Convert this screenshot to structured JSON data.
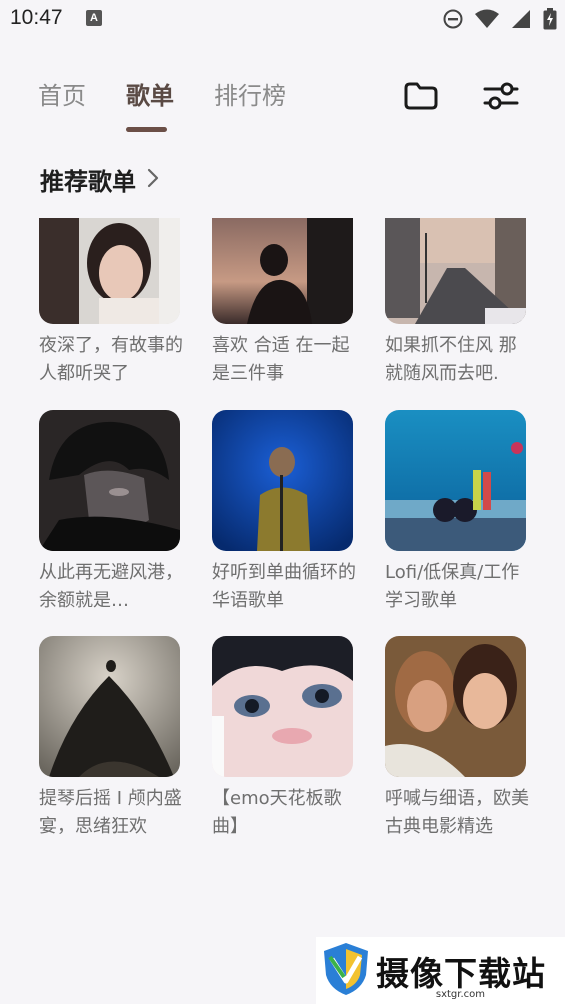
{
  "status_bar": {
    "time": "10:47",
    "app_badge": "A"
  },
  "tabs": [
    {
      "label": "首页",
      "active": false
    },
    {
      "label": "歌单",
      "active": true
    },
    {
      "label": "排行榜",
      "active": false
    }
  ],
  "header_icons": [
    "folder-icon",
    "filter-sliders-icon"
  ],
  "section": {
    "title": "推荐歌单"
  },
  "playlists": [
    {
      "title": "夜深了，有故事的人都听哭了"
    },
    {
      "title": "喜欢 合适 在一起 是三件事"
    },
    {
      "title": "如果抓不住风 那就随风而去吧."
    },
    {
      "title": "从此再无避风港，余额就是…"
    },
    {
      "title": "好听到单曲循环的华语歌单"
    },
    {
      "title": "Lofi/低保真/工作学习歌单"
    },
    {
      "title": "提琴后摇 I 颅内盛宴，思绪狂欢"
    },
    {
      "title": "【emo天花板歌曲】"
    },
    {
      "title": "呼喊与细语，欧美古典电影精选"
    }
  ],
  "watermark": {
    "text": "摄像下载站",
    "url": "sxtgr.com"
  },
  "colors": {
    "accent": "#6b4f47",
    "background": "#f6f5f8",
    "caption": "#6f6f6f"
  }
}
